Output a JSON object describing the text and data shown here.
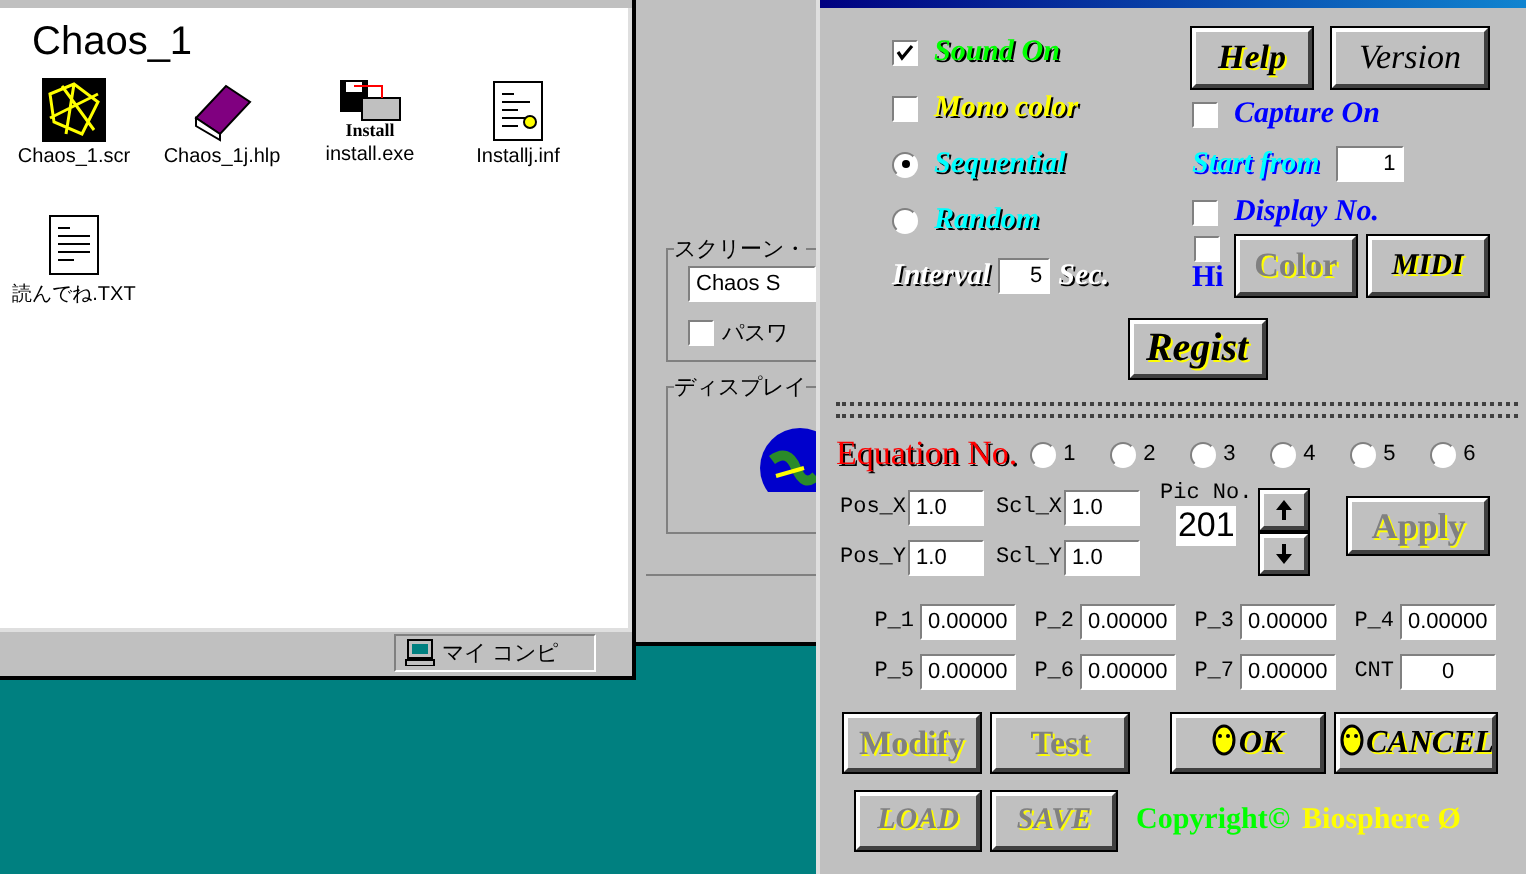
{
  "explorer": {
    "title": "Chaos_1",
    "icons": [
      {
        "kind": "chaos",
        "label": "Chaos_1.scr"
      },
      {
        "kind": "help",
        "label": "Chaos_1j.hlp"
      },
      {
        "kind": "install",
        "label": "install.exe",
        "caption": "Install"
      },
      {
        "kind": "inf",
        "label": "Installj.inf"
      },
      {
        "kind": "text",
        "label": "読んでね.TXT"
      }
    ],
    "status": "マイ コンピ"
  },
  "display_dialog": {
    "screensaver_group": "スクリーン・",
    "screensaver_value": "Chaos S",
    "password": {
      "label": "パスワ",
      "checked": false
    },
    "display_group": "ディスプレイ"
  },
  "setup": {
    "left_options": [
      {
        "kind": "checkbox",
        "label": "Sound On",
        "checked": true,
        "color": "#00ff00"
      },
      {
        "kind": "checkbox",
        "label": "Mono color",
        "checked": false,
        "color": "#ffff00"
      },
      {
        "kind": "radio",
        "label": "Sequential",
        "selected": true,
        "color": "#00ffff"
      },
      {
        "kind": "radio",
        "label": "Random",
        "selected": false,
        "color": "#00ffff"
      }
    ],
    "interval": {
      "label": "Interval",
      "value": "5",
      "unit": "Sec."
    },
    "help_button": "Help",
    "version_button": "Version",
    "capture_on": {
      "label": "Capture On",
      "checked": false
    },
    "start_from": {
      "label": "Start from",
      "value": "1"
    },
    "display_no": {
      "label": "Display No.",
      "checked": false
    },
    "hi": {
      "label": "Hi",
      "checked": false
    },
    "color_button": {
      "label": "Color",
      "disabled": true
    },
    "midi_button": {
      "label": "MIDI",
      "disabled": false
    },
    "regist_button": "Regist",
    "equation_label": "Equation No.",
    "equations": [
      {
        "label": "1",
        "selected": false
      },
      {
        "label": "2",
        "selected": false
      },
      {
        "label": "3",
        "selected": false
      },
      {
        "label": "4",
        "selected": false
      },
      {
        "label": "5",
        "selected": false
      },
      {
        "label": "6",
        "selected": false
      }
    ],
    "pos_fields": [
      {
        "label": "Pos_X",
        "value": "1.0"
      },
      {
        "label": "Scl_X",
        "value": "1.0"
      },
      {
        "label": "Pos_Y",
        "value": "1.0"
      },
      {
        "label": "Scl_Y",
        "value": "1.0"
      }
    ],
    "pic_no": {
      "label": "Pic No.",
      "value": "201"
    },
    "apply_button": {
      "label": "Apply",
      "disabled": true
    },
    "params": [
      {
        "label": "P_1",
        "value": "0.00000"
      },
      {
        "label": "P_2",
        "value": "0.00000"
      },
      {
        "label": "P_3",
        "value": "0.00000"
      },
      {
        "label": "P_4",
        "value": "0.00000"
      },
      {
        "label": "P_5",
        "value": "0.00000"
      },
      {
        "label": "P_6",
        "value": "0.00000"
      },
      {
        "label": "P_7",
        "value": "0.00000"
      },
      {
        "label": "CNT",
        "value": "0"
      }
    ],
    "buttons": [
      {
        "label": "Modify",
        "disabled": true,
        "kind": "plain"
      },
      {
        "label": "Test",
        "disabled": true,
        "kind": "plain"
      },
      {
        "label": "OK",
        "disabled": false,
        "kind": "italic"
      },
      {
        "label": "CANCEL",
        "disabled": false,
        "kind": "italic"
      },
      {
        "label": "LOAD",
        "disabled": true,
        "kind": "italic"
      },
      {
        "label": "SAVE",
        "disabled": true,
        "kind": "italic"
      }
    ],
    "copyright": "Copyright©",
    "author": "Biosphere Ø"
  }
}
